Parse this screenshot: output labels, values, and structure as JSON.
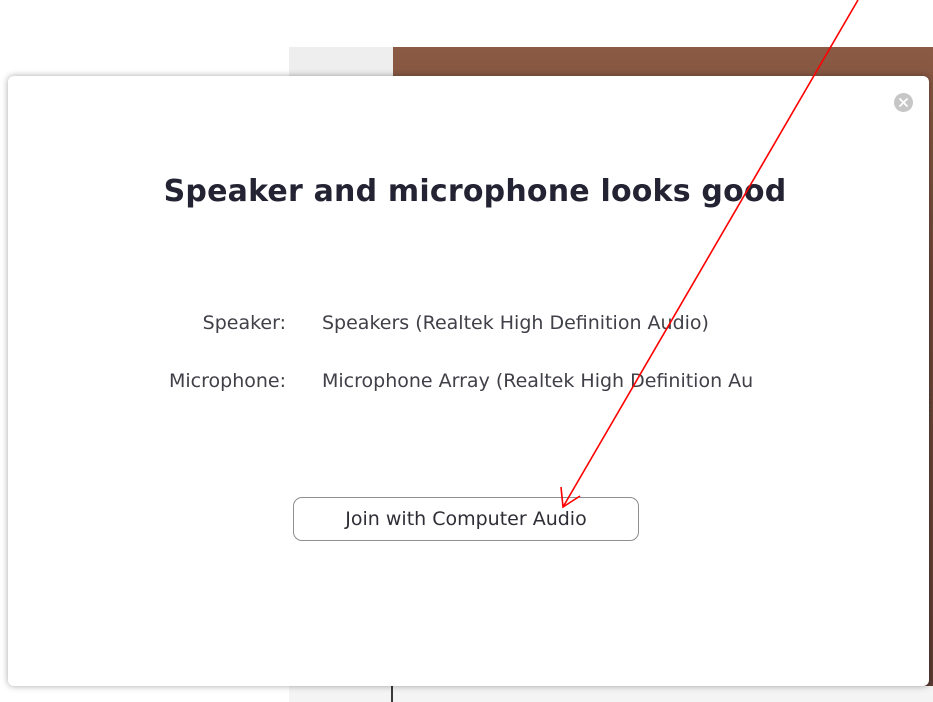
{
  "dialog": {
    "title": "Speaker and microphone looks good",
    "close_icon": "close-icon",
    "speaker_label": "Speaker:",
    "speaker_value": "Speakers (Realtek High Definition Audio)",
    "microphone_label": "Microphone:",
    "microphone_value": "Microphone Array (Realtek High Definition Au",
    "join_button_label": "Join with Computer Audio"
  },
  "colors": {
    "title_text": "#232333",
    "body_text": "#404048",
    "annotation_arrow": "#ff0000",
    "close_button_bg": "#c6c6c6"
  }
}
